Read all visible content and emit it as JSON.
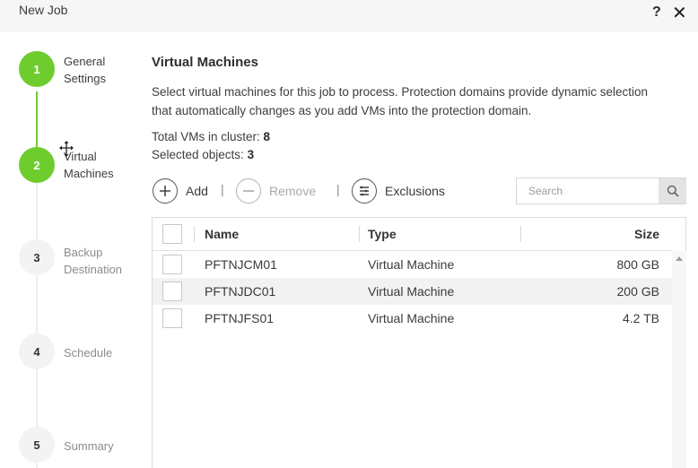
{
  "window": {
    "title": "New Job",
    "help": "?",
    "close": "✕"
  },
  "steps": [
    {
      "number": "1",
      "label": "General Settings",
      "state": "active"
    },
    {
      "number": "2",
      "label": "Virtual Machines",
      "state": "active"
    },
    {
      "number": "3",
      "label": "Backup Destination",
      "state": "pending"
    },
    {
      "number": "4",
      "label": "Schedule",
      "state": "pending"
    },
    {
      "number": "5",
      "label": "Summary",
      "state": "pending"
    }
  ],
  "main": {
    "title": "Virtual Machines",
    "description": "Select virtual machines for this job to process. Protection domains provide dynamic selection that automatically changes as you add VMs into the protection domain.",
    "total_label": "Total VMs in cluster: ",
    "total_value": "8",
    "selected_label": "Selected objects: ",
    "selected_value": "3"
  },
  "toolbar": {
    "add_label": "Add",
    "remove_label": "Remove",
    "exclusions_label": "Exclusions",
    "separator": "|",
    "search_placeholder": "Search"
  },
  "grid": {
    "columns": [
      "Name",
      "Type",
      "Size"
    ],
    "rows": [
      {
        "name": "PFTNJCM01",
        "type": "Virtual Machine",
        "size": "800 GB"
      },
      {
        "name": "PFTNJDC01",
        "type": "Virtual Machine",
        "size": "200 GB"
      },
      {
        "name": "PFTNJFS01",
        "type": "Virtual Machine",
        "size": "4.2 TB"
      }
    ]
  },
  "colors": {
    "step_active": "#6ecc2e",
    "step_pending": "#f3f3f3",
    "titlebar_bg": "#f6f6f6"
  }
}
